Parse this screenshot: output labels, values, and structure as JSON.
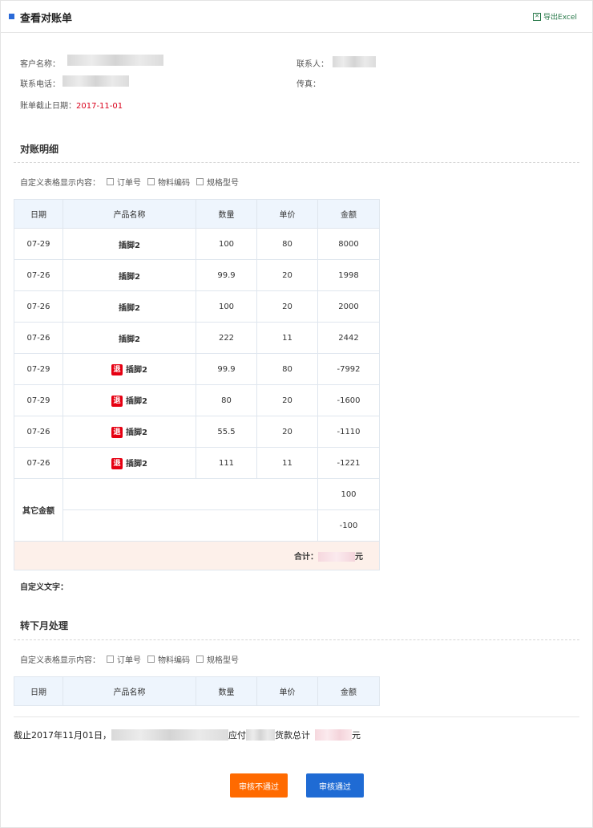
{
  "header": {
    "title": "查看对账单",
    "export_label": "导出Excel"
  },
  "info": {
    "customer_label": "客户名称：",
    "contact_label": "联系人：",
    "phone_label": "联系电话：",
    "fax_label": "传真：",
    "deadline_label": "账单截止日期：",
    "deadline_value": "2017-11-01"
  },
  "detail": {
    "section_title": "对账明细",
    "custom_label": "自定义表格显示内容：",
    "options": [
      "订单号",
      "物料编码",
      "规格型号"
    ],
    "columns": [
      "日期",
      "产品名称",
      "数量",
      "单价",
      "金额"
    ],
    "rows": [
      {
        "date": "07-29",
        "product": "插脚2",
        "qty": "100",
        "price": "80",
        "amount": "8000",
        "returned": false
      },
      {
        "date": "07-26",
        "product": "插脚2",
        "qty": "99.9",
        "price": "20",
        "amount": "1998",
        "returned": false
      },
      {
        "date": "07-26",
        "product": "插脚2",
        "qty": "100",
        "price": "20",
        "amount": "2000",
        "returned": false
      },
      {
        "date": "07-26",
        "product": "插脚2",
        "qty": "222",
        "price": "11",
        "amount": "2442",
        "returned": false
      },
      {
        "date": "07-29",
        "product": "插脚2",
        "qty": "99.9",
        "price": "80",
        "amount": "-7992",
        "returned": true
      },
      {
        "date": "07-29",
        "product": "插脚2",
        "qty": "80",
        "price": "20",
        "amount": "-1600",
        "returned": true
      },
      {
        "date": "07-26",
        "product": "插脚2",
        "qty": "55.5",
        "price": "20",
        "amount": "-1110",
        "returned": true
      },
      {
        "date": "07-26",
        "product": "插脚2",
        "qty": "111",
        "price": "11",
        "amount": "-1221",
        "returned": true
      }
    ],
    "return_tag": "退",
    "other_label": "其它金额",
    "other_amounts": [
      "100",
      "-100"
    ],
    "total_label": "合计：",
    "total_unit": "元"
  },
  "custom_text_label": "自定义文字：",
  "next_month": {
    "section_title": "转下月处理",
    "custom_label": "自定义表格显示内容：",
    "options": [
      "订单号",
      "物料编码",
      "规格型号"
    ],
    "columns": [
      "日期",
      "产品名称",
      "数量",
      "单价",
      "金额"
    ]
  },
  "summary": {
    "prefix": "截止2017年11月01日，",
    "mid1": "应付",
    "mid2": "货款总计",
    "suffix": "元"
  },
  "actions": {
    "reject_label": "审核不通过",
    "approve_label": "审核通过"
  },
  "colors": {
    "accent_blue": "#1f6bd4",
    "accent_orange": "#ff6a00",
    "return_red": "#e60012",
    "date_red": "#d9001b"
  }
}
